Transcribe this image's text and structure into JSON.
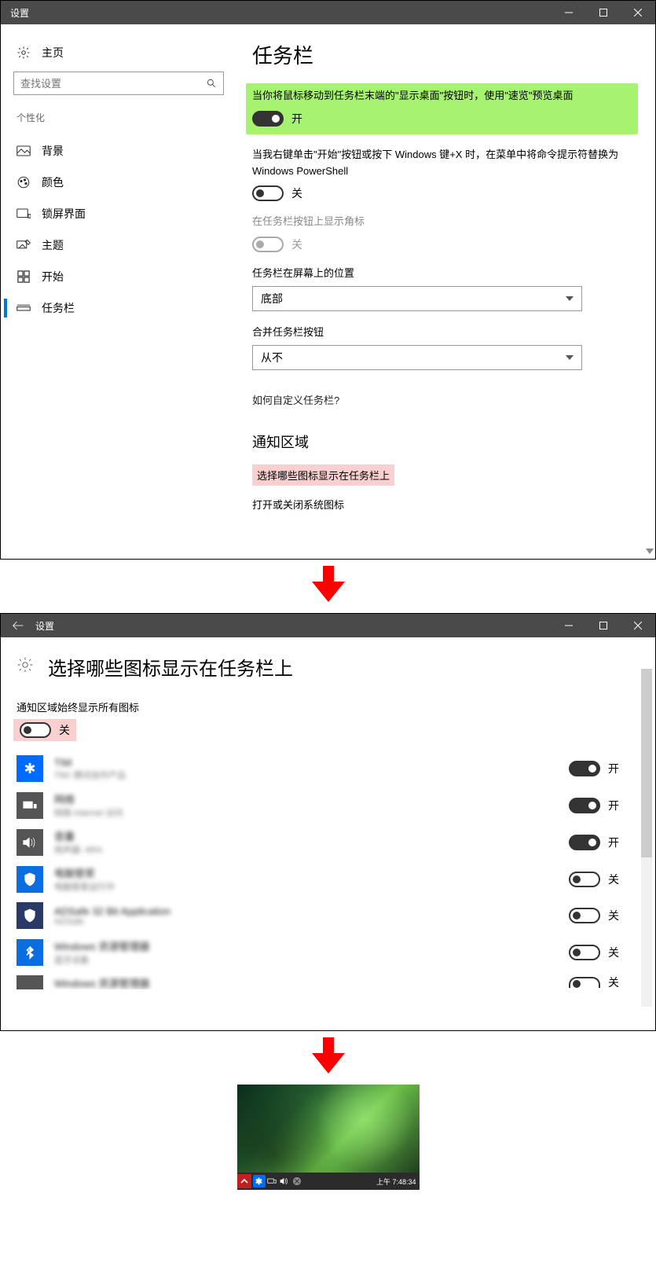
{
  "win": {
    "title": "设置"
  },
  "sidebar": {
    "home": "主页",
    "search_placeholder": "查找设置",
    "category": "个性化",
    "items": [
      {
        "label": "背景"
      },
      {
        "label": "颜色"
      },
      {
        "label": "锁屏界面"
      },
      {
        "label": "主题"
      },
      {
        "label": "开始"
      },
      {
        "label": "任务栏"
      }
    ]
  },
  "main": {
    "title": "任务栏",
    "peek": {
      "text": "当你将鼠标移动到任务栏末端的\"显示桌面\"按钮时，使用\"速览\"预览桌面",
      "state": "开"
    },
    "powershell": {
      "text": "当我右键单击\"开始\"按钮或按下 Windows 键+X 时，在菜单中将命令提示符替换为 Windows PowerShell",
      "state": "关"
    },
    "badges": {
      "text": "在任务栏按钮上显示角标",
      "state": "关"
    },
    "position": {
      "label": "任务栏在屏幕上的位置",
      "value": "底部"
    },
    "combine": {
      "label": "合并任务栏按钮",
      "value": "从不"
    },
    "customize_link": "如何自定义任务栏?",
    "notif_head": "通知区域",
    "select_icons": "选择哪些图标显示在任务栏上",
    "sys_icons": "打开或关闭系统图标"
  },
  "page2": {
    "title": "选择哪些图标显示在任务栏上",
    "master_label": "通知区域始终显示所有图标",
    "master_state": "关",
    "rows": [
      {
        "name": "TIM",
        "sub": "TIM: 腾讯协作产品",
        "state": "开",
        "tile": "blue-star"
      },
      {
        "name": "网络",
        "sub": "网络 Internet 访问",
        "state": "开",
        "tile": "net"
      },
      {
        "name": "音量",
        "sub": "扬声器: 48%",
        "state": "开",
        "tile": "vol"
      },
      {
        "name": "电脑管家",
        "sub": "电脑管家运行中",
        "state": "关",
        "tile": "shield-blue"
      },
      {
        "name": "ADSafe 32 Bit Application",
        "sub": "ADSafe",
        "state": "关",
        "tile": "shield-dark"
      },
      {
        "name": "Windows 资源管理器",
        "sub": "蓝牙设备",
        "state": "关",
        "tile": "bt"
      },
      {
        "name": "Windows 资源管理器",
        "sub": "",
        "state": "关",
        "tile": "dark"
      }
    ]
  },
  "tray": {
    "time": "上午 7:48:34"
  },
  "labels": {
    "on": "开",
    "off": "关"
  }
}
